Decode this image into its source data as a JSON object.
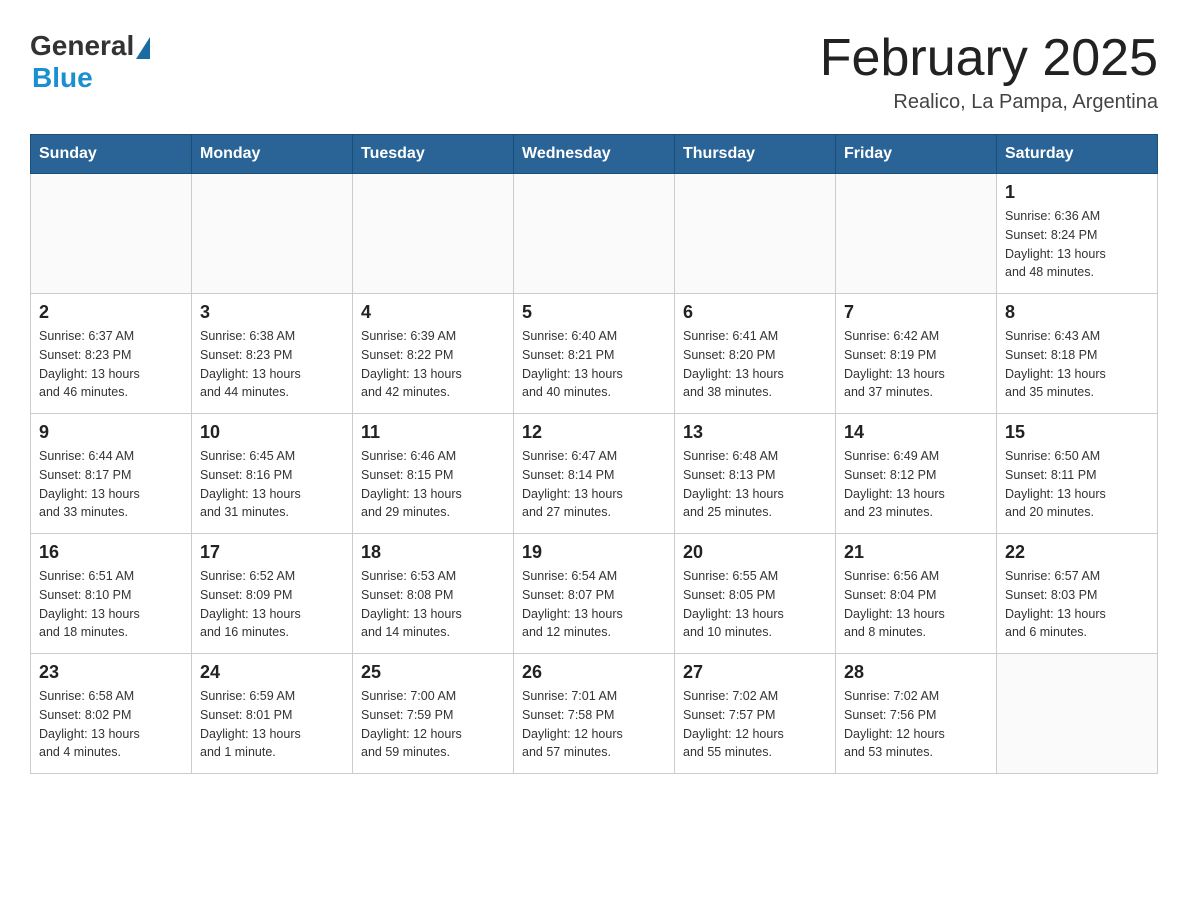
{
  "header": {
    "logo_general": "General",
    "logo_blue": "Blue",
    "month_title": "February 2025",
    "location": "Realico, La Pampa, Argentina"
  },
  "weekdays": [
    "Sunday",
    "Monday",
    "Tuesday",
    "Wednesday",
    "Thursday",
    "Friday",
    "Saturday"
  ],
  "weeks": [
    [
      {
        "day": "",
        "info": ""
      },
      {
        "day": "",
        "info": ""
      },
      {
        "day": "",
        "info": ""
      },
      {
        "day": "",
        "info": ""
      },
      {
        "day": "",
        "info": ""
      },
      {
        "day": "",
        "info": ""
      },
      {
        "day": "1",
        "info": "Sunrise: 6:36 AM\nSunset: 8:24 PM\nDaylight: 13 hours\nand 48 minutes."
      }
    ],
    [
      {
        "day": "2",
        "info": "Sunrise: 6:37 AM\nSunset: 8:23 PM\nDaylight: 13 hours\nand 46 minutes."
      },
      {
        "day": "3",
        "info": "Sunrise: 6:38 AM\nSunset: 8:23 PM\nDaylight: 13 hours\nand 44 minutes."
      },
      {
        "day": "4",
        "info": "Sunrise: 6:39 AM\nSunset: 8:22 PM\nDaylight: 13 hours\nand 42 minutes."
      },
      {
        "day": "5",
        "info": "Sunrise: 6:40 AM\nSunset: 8:21 PM\nDaylight: 13 hours\nand 40 minutes."
      },
      {
        "day": "6",
        "info": "Sunrise: 6:41 AM\nSunset: 8:20 PM\nDaylight: 13 hours\nand 38 minutes."
      },
      {
        "day": "7",
        "info": "Sunrise: 6:42 AM\nSunset: 8:19 PM\nDaylight: 13 hours\nand 37 minutes."
      },
      {
        "day": "8",
        "info": "Sunrise: 6:43 AM\nSunset: 8:18 PM\nDaylight: 13 hours\nand 35 minutes."
      }
    ],
    [
      {
        "day": "9",
        "info": "Sunrise: 6:44 AM\nSunset: 8:17 PM\nDaylight: 13 hours\nand 33 minutes."
      },
      {
        "day": "10",
        "info": "Sunrise: 6:45 AM\nSunset: 8:16 PM\nDaylight: 13 hours\nand 31 minutes."
      },
      {
        "day": "11",
        "info": "Sunrise: 6:46 AM\nSunset: 8:15 PM\nDaylight: 13 hours\nand 29 minutes."
      },
      {
        "day": "12",
        "info": "Sunrise: 6:47 AM\nSunset: 8:14 PM\nDaylight: 13 hours\nand 27 minutes."
      },
      {
        "day": "13",
        "info": "Sunrise: 6:48 AM\nSunset: 8:13 PM\nDaylight: 13 hours\nand 25 minutes."
      },
      {
        "day": "14",
        "info": "Sunrise: 6:49 AM\nSunset: 8:12 PM\nDaylight: 13 hours\nand 23 minutes."
      },
      {
        "day": "15",
        "info": "Sunrise: 6:50 AM\nSunset: 8:11 PM\nDaylight: 13 hours\nand 20 minutes."
      }
    ],
    [
      {
        "day": "16",
        "info": "Sunrise: 6:51 AM\nSunset: 8:10 PM\nDaylight: 13 hours\nand 18 minutes."
      },
      {
        "day": "17",
        "info": "Sunrise: 6:52 AM\nSunset: 8:09 PM\nDaylight: 13 hours\nand 16 minutes."
      },
      {
        "day": "18",
        "info": "Sunrise: 6:53 AM\nSunset: 8:08 PM\nDaylight: 13 hours\nand 14 minutes."
      },
      {
        "day": "19",
        "info": "Sunrise: 6:54 AM\nSunset: 8:07 PM\nDaylight: 13 hours\nand 12 minutes."
      },
      {
        "day": "20",
        "info": "Sunrise: 6:55 AM\nSunset: 8:05 PM\nDaylight: 13 hours\nand 10 minutes."
      },
      {
        "day": "21",
        "info": "Sunrise: 6:56 AM\nSunset: 8:04 PM\nDaylight: 13 hours\nand 8 minutes."
      },
      {
        "day": "22",
        "info": "Sunrise: 6:57 AM\nSunset: 8:03 PM\nDaylight: 13 hours\nand 6 minutes."
      }
    ],
    [
      {
        "day": "23",
        "info": "Sunrise: 6:58 AM\nSunset: 8:02 PM\nDaylight: 13 hours\nand 4 minutes."
      },
      {
        "day": "24",
        "info": "Sunrise: 6:59 AM\nSunset: 8:01 PM\nDaylight: 13 hours\nand 1 minute."
      },
      {
        "day": "25",
        "info": "Sunrise: 7:00 AM\nSunset: 7:59 PM\nDaylight: 12 hours\nand 59 minutes."
      },
      {
        "day": "26",
        "info": "Sunrise: 7:01 AM\nSunset: 7:58 PM\nDaylight: 12 hours\nand 57 minutes."
      },
      {
        "day": "27",
        "info": "Sunrise: 7:02 AM\nSunset: 7:57 PM\nDaylight: 12 hours\nand 55 minutes."
      },
      {
        "day": "28",
        "info": "Sunrise: 7:02 AM\nSunset: 7:56 PM\nDaylight: 12 hours\nand 53 minutes."
      },
      {
        "day": "",
        "info": ""
      }
    ]
  ]
}
